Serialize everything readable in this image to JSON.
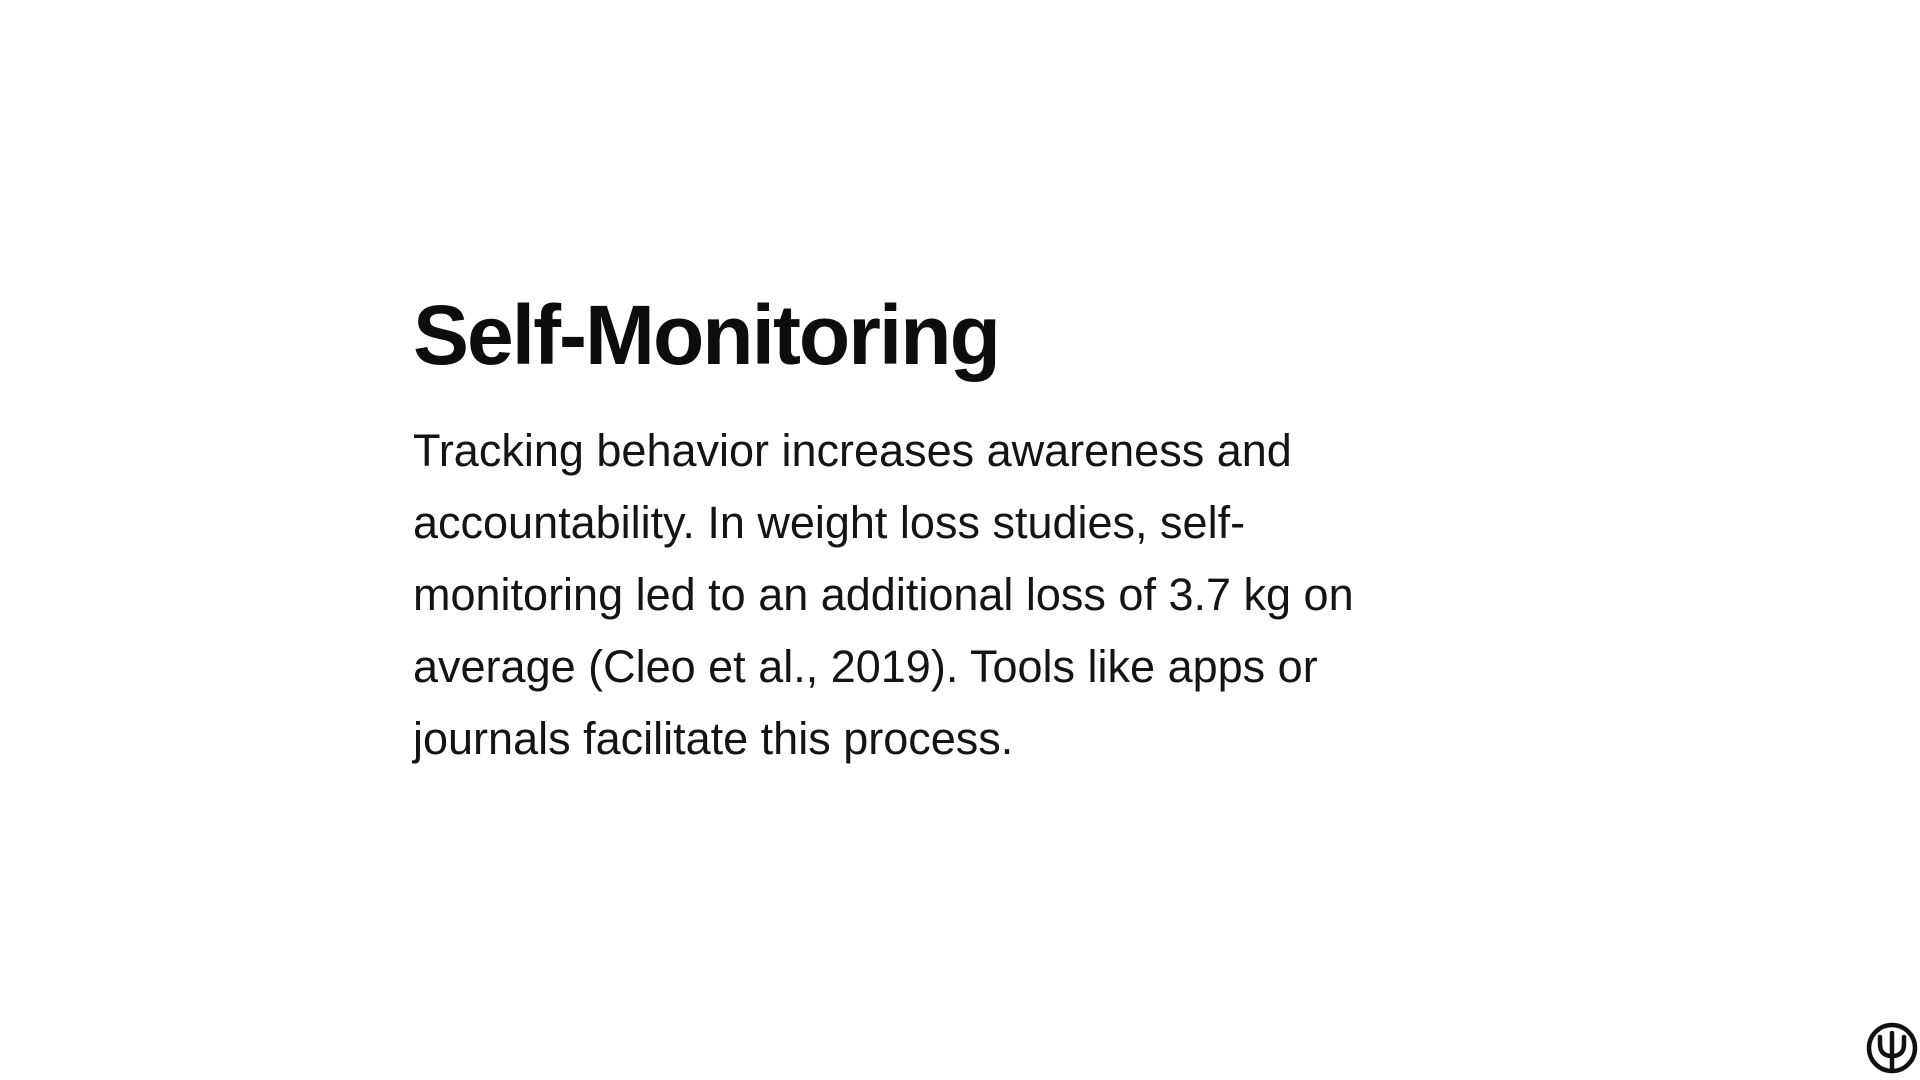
{
  "slide": {
    "title": "Self-Monitoring",
    "body": "Tracking behavior increases awareness and accountability. In weight loss studies, self-monitoring led to an additional loss of 3.7 kg on average (Cleo et al., 2019). Tools like apps or journals facilitate this process."
  },
  "logo": {
    "icon": "psi-icon",
    "color": "#111111"
  }
}
